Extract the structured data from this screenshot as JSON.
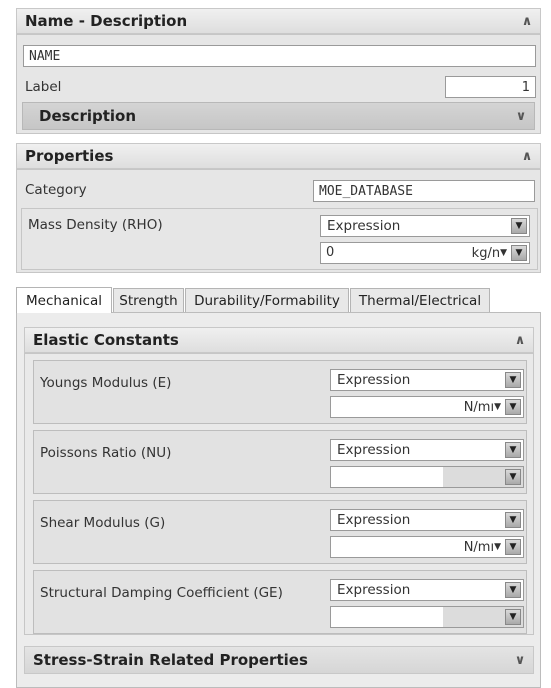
{
  "name_section": {
    "header": "Name - Description",
    "name_value": "NAME",
    "label_text": "Label",
    "label_value": "1",
    "description_header": "Description",
    "collapse_icon": "chevron-up-icon",
    "expand_icon": "chevron-down-icon"
  },
  "properties_section": {
    "header": "Properties",
    "category_label": "Category",
    "category_value": "MOE_DATABASE",
    "mass_density_label": "Mass Density (RHO)",
    "mass_density_mode": "Expression",
    "mass_density_value": "0",
    "mass_density_unit": "kg/n"
  },
  "tabs": [
    "Mechanical",
    "Strength",
    "Durability/Formability",
    "Thermal/Electrical"
  ],
  "elastic_section": {
    "header": "Elastic Constants",
    "fields": [
      {
        "label": "Youngs Modulus (E)",
        "mode": "Expression",
        "value": "",
        "unit": "N/mı"
      },
      {
        "label": "Poissons Ratio (NU)",
        "mode": "Expression",
        "value": "",
        "unit": ""
      },
      {
        "label": "Shear Modulus (G)",
        "mode": "Expression",
        "value": "",
        "unit": "N/mı"
      },
      {
        "label": "Structural Damping Coefficient (GE)",
        "mode": "Expression",
        "value": "",
        "unit": ""
      }
    ]
  },
  "stress_strain_section": {
    "header": "Stress-Strain Related Properties"
  }
}
